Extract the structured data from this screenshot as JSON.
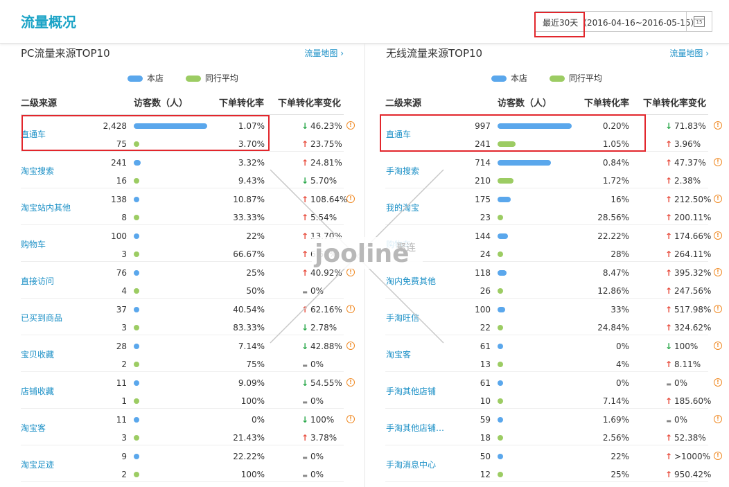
{
  "header": {
    "title": "流量概况",
    "date_label": "最近30天",
    "date_range": "（2016-04-16~2016-05-15）",
    "calendar_num": "15"
  },
  "legend": {
    "own": "本店",
    "peer": "同行平均"
  },
  "colors": {
    "own": "#5aa7ec",
    "peer": "#9ccc63",
    "accent": "#1aa3c6",
    "highlight": "#e2262c"
  },
  "watermark": {
    "text": "jooline",
    "cn": "聚连"
  },
  "pc": {
    "title": "PC流量来源TOP10",
    "map_link": "流量地图",
    "headers": {
      "source": "二级来源",
      "visitors": "访客数（人）",
      "conversion": "下单转化率",
      "change": "下单转化率变化"
    },
    "rows": [
      {
        "name": "直通车",
        "own": {
          "visitors": "2,428",
          "bar": 1.0,
          "rate": "1.07%",
          "dir": "down",
          "chg": "46.23%"
        },
        "peer": {
          "visitors": "75",
          "bar": 0.031,
          "rate": "3.70%",
          "dir": "up",
          "chg": "23.75%"
        },
        "warn": true
      },
      {
        "name": "淘宝搜索",
        "own": {
          "visitors": "241",
          "bar": 0.099,
          "rate": "3.32%",
          "dir": "up",
          "chg": "24.81%"
        },
        "peer": {
          "visitors": "16",
          "bar": 0.007,
          "rate": "9.43%",
          "dir": "down",
          "chg": "5.70%"
        },
        "warn": false
      },
      {
        "name": "淘宝站内其他",
        "own": {
          "visitors": "138",
          "bar": 0.057,
          "rate": "10.87%",
          "dir": "up",
          "chg": "108.64%"
        },
        "peer": {
          "visitors": "8",
          "bar": 0.003,
          "rate": "33.33%",
          "dir": "up",
          "chg": "5.54%"
        },
        "warn": true
      },
      {
        "name": "购物车",
        "own": {
          "visitors": "100",
          "bar": 0.041,
          "rate": "22%",
          "dir": "up",
          "chg": "13.70%"
        },
        "peer": {
          "visitors": "3",
          "bar": 0.001,
          "rate": "66.67%",
          "dir": "up",
          "chg": "6.67%"
        },
        "warn": false
      },
      {
        "name": "直接访问",
        "own": {
          "visitors": "76",
          "bar": 0.031,
          "rate": "25%",
          "dir": "up",
          "chg": "40.92%"
        },
        "peer": {
          "visitors": "4",
          "bar": 0.002,
          "rate": "50%",
          "dir": "flat",
          "chg": "0%"
        },
        "warn": true
      },
      {
        "name": "已买到商品",
        "own": {
          "visitors": "37",
          "bar": 0.015,
          "rate": "40.54%",
          "dir": "up",
          "chg": "62.16%"
        },
        "peer": {
          "visitors": "3",
          "bar": 0.001,
          "rate": "83.33%",
          "dir": "down",
          "chg": "2.78%"
        },
        "warn": true
      },
      {
        "name": "宝贝收藏",
        "own": {
          "visitors": "28",
          "bar": 0.012,
          "rate": "7.14%",
          "dir": "down",
          "chg": "42.88%"
        },
        "peer": {
          "visitors": "2",
          "bar": 0.001,
          "rate": "75%",
          "dir": "flat",
          "chg": "0%"
        },
        "warn": true
      },
      {
        "name": "店铺收藏",
        "own": {
          "visitors": "11",
          "bar": 0.005,
          "rate": "9.09%",
          "dir": "down",
          "chg": "54.55%"
        },
        "peer": {
          "visitors": "1",
          "bar": 0.0,
          "rate": "100%",
          "dir": "flat",
          "chg": "0%"
        },
        "warn": true
      },
      {
        "name": "淘宝客",
        "own": {
          "visitors": "11",
          "bar": 0.005,
          "rate": "0%",
          "dir": "down",
          "chg": "100%"
        },
        "peer": {
          "visitors": "3",
          "bar": 0.001,
          "rate": "21.43%",
          "dir": "up",
          "chg": "3.78%"
        },
        "warn": true
      },
      {
        "name": "淘宝足迹",
        "own": {
          "visitors": "9",
          "bar": 0.004,
          "rate": "22.22%",
          "dir": "flat",
          "chg": "0%"
        },
        "peer": {
          "visitors": "2",
          "bar": 0.001,
          "rate": "100%",
          "dir": "flat",
          "chg": "0%"
        },
        "warn": false
      }
    ]
  },
  "mobile": {
    "title": "无线流量来源TOP10",
    "map_link": "流量地图",
    "headers": {
      "source": "二级来源",
      "visitors": "访客数（人）",
      "conversion": "下单转化率",
      "change": "下单转化率变化"
    },
    "rows": [
      {
        "name": "直通车",
        "own": {
          "visitors": "997",
          "bar": 1.0,
          "rate": "0.20%",
          "dir": "down",
          "chg": "71.83%"
        },
        "peer": {
          "visitors": "241",
          "bar": 0.242,
          "rate": "1.05%",
          "dir": "up",
          "chg": "3.96%"
        },
        "warn": true
      },
      {
        "name": "手淘搜索",
        "own": {
          "visitors": "714",
          "bar": 0.716,
          "rate": "0.84%",
          "dir": "up",
          "chg": "47.37%"
        },
        "peer": {
          "visitors": "210",
          "bar": 0.211,
          "rate": "1.72%",
          "dir": "up",
          "chg": "2.38%"
        },
        "warn": true
      },
      {
        "name": "我的淘宝",
        "own": {
          "visitors": "175",
          "bar": 0.176,
          "rate": "16%",
          "dir": "up",
          "chg": "212.50%"
        },
        "peer": {
          "visitors": "23",
          "bar": 0.023,
          "rate": "28.56%",
          "dir": "up",
          "chg": "200.11%"
        },
        "warn": true
      },
      {
        "name": "购物车",
        "own": {
          "visitors": "144",
          "bar": 0.144,
          "rate": "22.22%",
          "dir": "up",
          "chg": "174.66%"
        },
        "peer": {
          "visitors": "24",
          "bar": 0.024,
          "rate": "28%",
          "dir": "up",
          "chg": "264.11%"
        },
        "warn": true
      },
      {
        "name": "淘内免费其他",
        "own": {
          "visitors": "118",
          "bar": 0.118,
          "rate": "8.47%",
          "dir": "up",
          "chg": "395.32%"
        },
        "peer": {
          "visitors": "26",
          "bar": 0.026,
          "rate": "12.86%",
          "dir": "up",
          "chg": "247.56%"
        },
        "warn": true
      },
      {
        "name": "手淘旺信",
        "own": {
          "visitors": "100",
          "bar": 0.1,
          "rate": "33%",
          "dir": "up",
          "chg": "517.98%"
        },
        "peer": {
          "visitors": "22",
          "bar": 0.022,
          "rate": "24.84%",
          "dir": "up",
          "chg": "324.62%"
        },
        "warn": true
      },
      {
        "name": "淘宝客",
        "own": {
          "visitors": "61",
          "bar": 0.061,
          "rate": "0%",
          "dir": "down",
          "chg": "100%"
        },
        "peer": {
          "visitors": "13",
          "bar": 0.013,
          "rate": "4%",
          "dir": "up",
          "chg": "8.11%"
        },
        "warn": true
      },
      {
        "name": "手淘其他店铺",
        "own": {
          "visitors": "61",
          "bar": 0.061,
          "rate": "0%",
          "dir": "flat",
          "chg": "0%"
        },
        "peer": {
          "visitors": "10",
          "bar": 0.01,
          "rate": "7.14%",
          "dir": "up",
          "chg": "185.60%"
        },
        "warn": true
      },
      {
        "name": "手淘其他店铺…",
        "own": {
          "visitors": "59",
          "bar": 0.059,
          "rate": "1.69%",
          "dir": "flat",
          "chg": "0%"
        },
        "peer": {
          "visitors": "18",
          "bar": 0.018,
          "rate": "2.56%",
          "dir": "up",
          "chg": "52.38%"
        },
        "warn": true
      },
      {
        "name": "手淘消息中心",
        "own": {
          "visitors": "50",
          "bar": 0.05,
          "rate": "22%",
          "dir": "up",
          "chg": ">1000%"
        },
        "peer": {
          "visitors": "12",
          "bar": 0.012,
          "rate": "25%",
          "dir": "up",
          "chg": "950.42%"
        },
        "warn": true
      }
    ]
  }
}
